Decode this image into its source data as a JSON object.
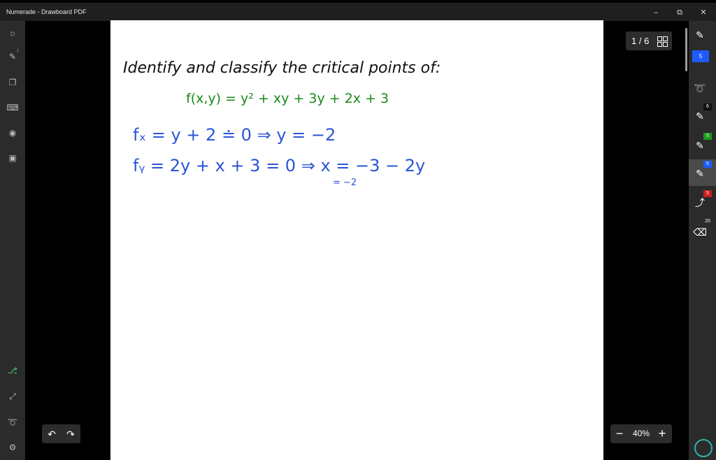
{
  "window": {
    "title": "Numerade - Drawboard PDF",
    "min_glyph": "–",
    "restore_glyph": "⧉",
    "close_glyph": "✕"
  },
  "left_rail": {
    "icons": [
      "sun-icon",
      "pen-icon",
      "copy-icon",
      "keyboard-icon",
      "binoculars-icon",
      "save-icon",
      "ruler-icon",
      "fullscreen-icon",
      "lasso-icon",
      "settings-icon"
    ],
    "pen_sup": "1"
  },
  "document": {
    "lines": [
      {
        "text": "Identify and classify the critical points of:",
        "color": "#111111"
      },
      {
        "text": "f(x,y) = y² + xy + 3y + 2x + 3",
        "color": "#1a8a1a"
      },
      {
        "text": "fₓ = y + 2 ≐ 0  ⇒ y = −2",
        "color": "#2a55d8"
      },
      {
        "text": "fᵧ = 2y + x + 3 = 0 ⇒ x = −3 − 2y",
        "color": "#2a55d8"
      },
      {
        "text": "= −2",
        "color": "#2a55d8"
      }
    ]
  },
  "page_indicator": {
    "text": "1 / 6"
  },
  "zoom": {
    "minus": "−",
    "value": "40%",
    "plus": "+"
  },
  "undo_glyph": "↶",
  "redo_glyph": "↷",
  "right_rail": {
    "tools": [
      {
        "name": "pen-tool",
        "glyph": "✎",
        "badge": "",
        "badge_color": "",
        "selected": false
      },
      {
        "name": "color-swatch",
        "glyph": "",
        "badge": "5",
        "badge_color": "#1e5bff",
        "selected": false
      },
      {
        "name": "lasso-tool",
        "glyph": "➰",
        "badge": "",
        "badge_color": "",
        "selected": false
      },
      {
        "name": "pen-black",
        "glyph": "✎",
        "badge": "6",
        "badge_color": "#111111",
        "selected": false
      },
      {
        "name": "pen-green",
        "glyph": "✎",
        "badge": "5",
        "badge_color": "#1a9a1a",
        "selected": false
      },
      {
        "name": "pen-blue",
        "glyph": "✎",
        "badge": "5",
        "badge_color": "#1e5bff",
        "selected": true
      },
      {
        "name": "pen-red",
        "glyph": "⤴",
        "badge": "5",
        "badge_color": "#cc1f1f",
        "selected": false
      },
      {
        "name": "eraser-tool",
        "glyph": "⌫",
        "badge": "20",
        "badge_color": "",
        "selected": false
      }
    ]
  }
}
